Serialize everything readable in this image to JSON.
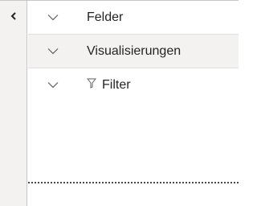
{
  "rail": {
    "collapse_icon": "chevron-left-icon"
  },
  "sections": [
    {
      "label": "Felder",
      "icon": "chevron-down-icon",
      "expanded": false
    },
    {
      "label": "Visualisierungen",
      "icon": "chevron-down-icon",
      "expanded": false
    },
    {
      "label": "Filter",
      "icon": "chevron-down-icon",
      "label_icon": "filter-icon",
      "expanded": false
    }
  ],
  "colors": {
    "rail_background": "#f3f2f1",
    "alt_row_background": "#f3f2f1",
    "border": "#c8c6c4",
    "text": "#252423"
  }
}
